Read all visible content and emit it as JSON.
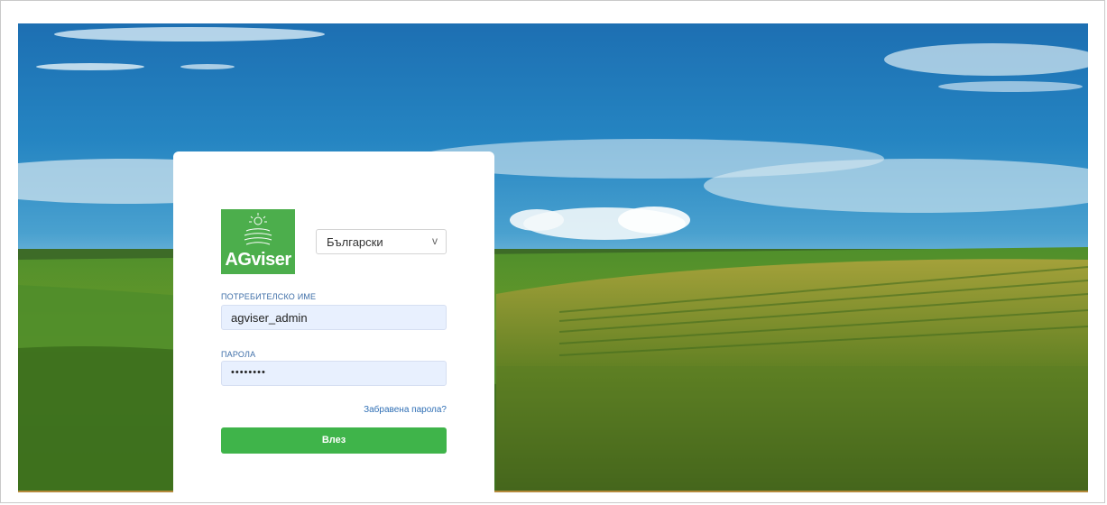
{
  "brand": {
    "logo_text": "AGviser",
    "color": "#4cae4c"
  },
  "language": {
    "selected": "Български"
  },
  "form": {
    "username_label": "ПОТРЕБИТЕЛСКО ИМЕ",
    "username_value": "agviser_admin",
    "password_label": "ПАРОЛА",
    "password_value": "••••••••",
    "forgot_link": "Забравена парола?",
    "login_button": "Влез",
    "button_color": "#3fb44a"
  },
  "icons": {
    "language_dropdown": "chevron-down-icon",
    "logo": "sun-fields-logo-icon"
  }
}
